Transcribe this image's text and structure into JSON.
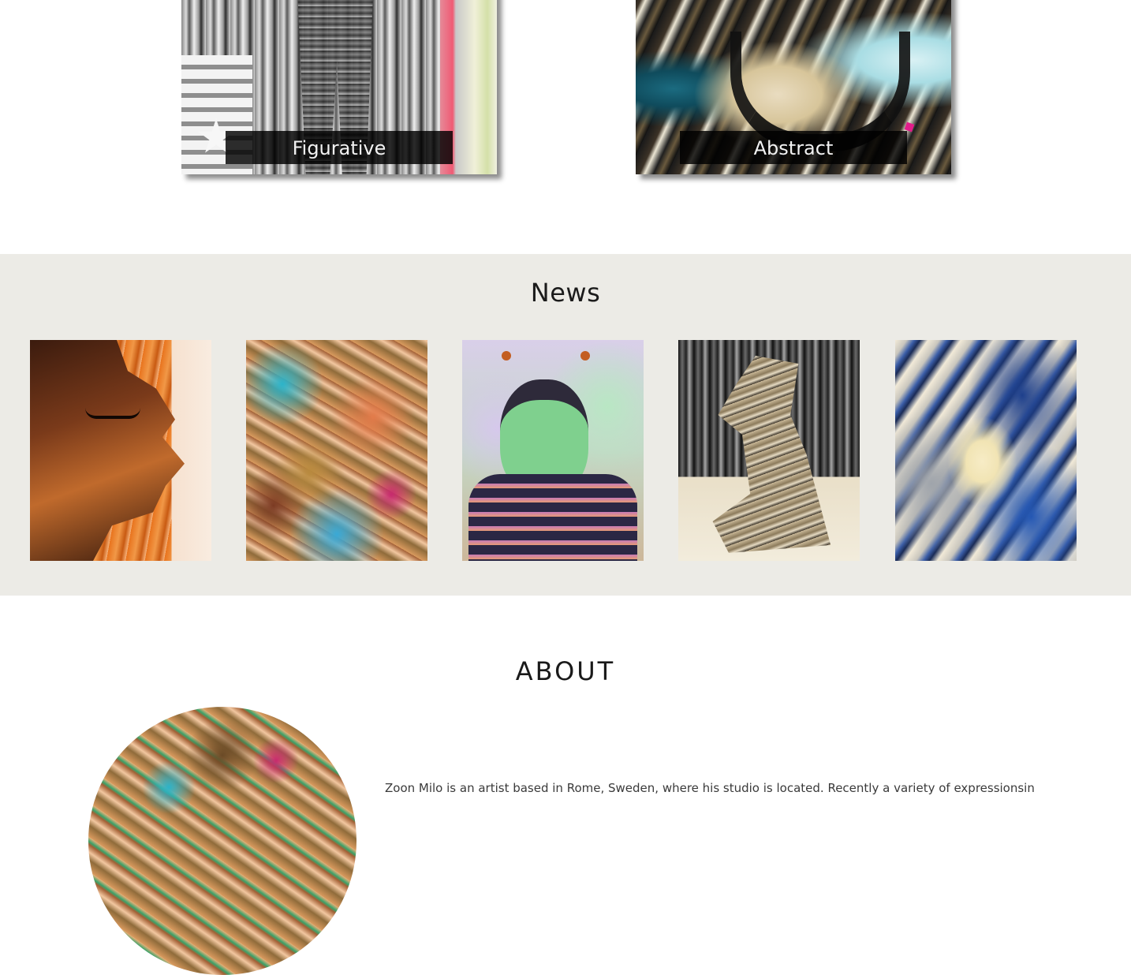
{
  "categories": [
    {
      "label": "Figurative"
    },
    {
      "label": "Abstract"
    }
  ],
  "news": {
    "title": "News"
  },
  "about": {
    "title": "ABOUT",
    "text": "Zoon Milo is an artist based in Rome, Sweden, where his studio is located. Recently a variety of expressionsin"
  },
  "colors": {
    "news_background": "#ecebe6",
    "label_background": "#1a1a1a",
    "label_text": "#f2f2f2"
  }
}
